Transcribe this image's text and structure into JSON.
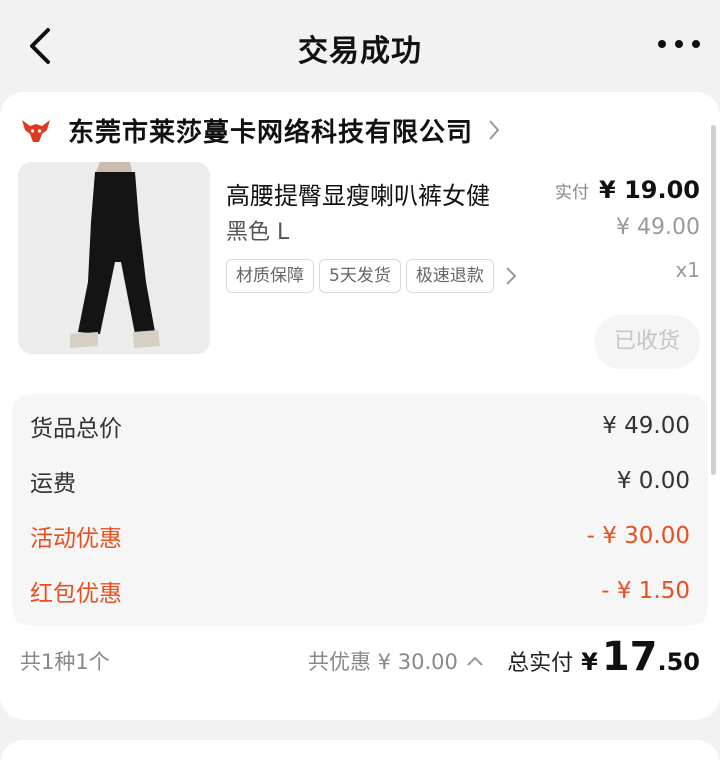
{
  "nav": {
    "title": "交易成功"
  },
  "shop": {
    "name": "东莞市莱莎蔓卡网络科技有限公司"
  },
  "product": {
    "title": "高腰提臀显瘦喇叭裤女健",
    "spec": "黑色 L",
    "tags": [
      "材质保障",
      "5天发货",
      "极速退款"
    ],
    "paid_label": "实付",
    "paid_price": "¥ 19.00",
    "original_price": "¥ 49.00",
    "quantity": "x1",
    "status_button": "已收货"
  },
  "summary": {
    "rows": [
      {
        "label": "货品总价",
        "value": "¥ 49.00"
      },
      {
        "label": "运费",
        "value": "¥ 0.00"
      },
      {
        "label": "活动优惠",
        "value": "- ¥ 30.00"
      },
      {
        "label": "红包优惠",
        "value": "- ¥ 1.50"
      }
    ]
  },
  "totals": {
    "count": "共1种1个",
    "discount": "共优惠 ¥ 30.00",
    "total_label": "总实付",
    "total_currency": "¥",
    "total_integer": "17",
    "total_decimal": ".50"
  },
  "colors": {
    "discount_red": "#e8501f",
    "background": "#f2f2f2",
    "brand_red": "#e03a1e"
  },
  "icons": [
    "back-arrow-icon",
    "more-dots-icon",
    "shop-logo-icon",
    "chevron-right-icon",
    "chevron-up-icon"
  ]
}
